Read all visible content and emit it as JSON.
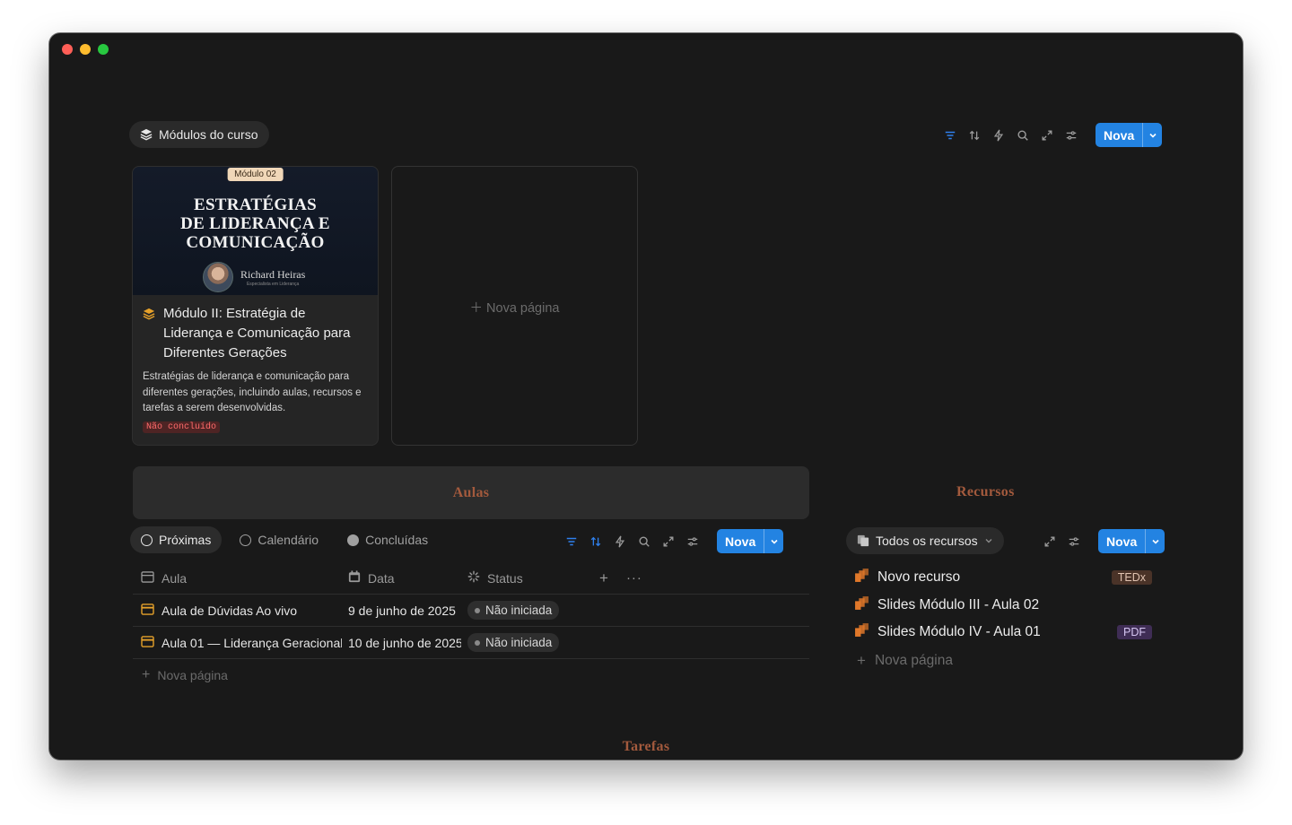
{
  "modules": {
    "pill_label": "Módulos do curso",
    "nova_label": "Nova",
    "card": {
      "cover_badge": "Módulo 02",
      "cover_title_lines": [
        "ESTRATÉGIAS",
        "DE LIDERANÇA E",
        "COMUNICAÇÃO"
      ],
      "cover_author": "Richard Heiras",
      "cover_author_sub": "Especialista em Liderança",
      "title": "Módulo II: Estratégia de Liderança e Comunicação para Diferentes Gerações",
      "description": "Estratégias de liderança e comunicação para diferentes gerações, incluindo aulas, recursos e tarefas a serem desenvolvidas.",
      "status_tag": "Não concluído"
    },
    "new_page_label": "Nova página"
  },
  "aulas": {
    "title": "Aulas",
    "tabs": [
      {
        "label": "Próximas",
        "active": true
      },
      {
        "label": "Calendário",
        "active": false
      },
      {
        "label": "Concluídas",
        "active": false
      }
    ],
    "nova_label": "Nova",
    "columns": {
      "aula": "Aula",
      "data": "Data",
      "status": "Status"
    },
    "rows": [
      {
        "aula": "Aula de Dúvidas Ao vivo",
        "data": "9 de junho de 2025",
        "status": "Não iniciada"
      },
      {
        "aula": "Aula 01 — Liderança Geracional",
        "data": "10 de junho de 2025",
        "status": "Não iniciada"
      }
    ],
    "new_page_label": "Nova página"
  },
  "recursos": {
    "title": "Recursos",
    "filter_label": "Todos os recursos",
    "nova_label": "Nova",
    "items": [
      {
        "name": "Novo recurso",
        "tag": "TEDx"
      },
      {
        "name": "Slides Módulo III - Aula 02",
        "tag": ""
      },
      {
        "name": "Slides Módulo IV - Aula 01",
        "tag": "PDF"
      }
    ],
    "new_page_label": "Nova página"
  },
  "tarefas": {
    "title": "Tarefas"
  },
  "colors": {
    "accent": "#2383e2",
    "section_title": "#a35a3d",
    "icon_orange": "#e0782a"
  }
}
